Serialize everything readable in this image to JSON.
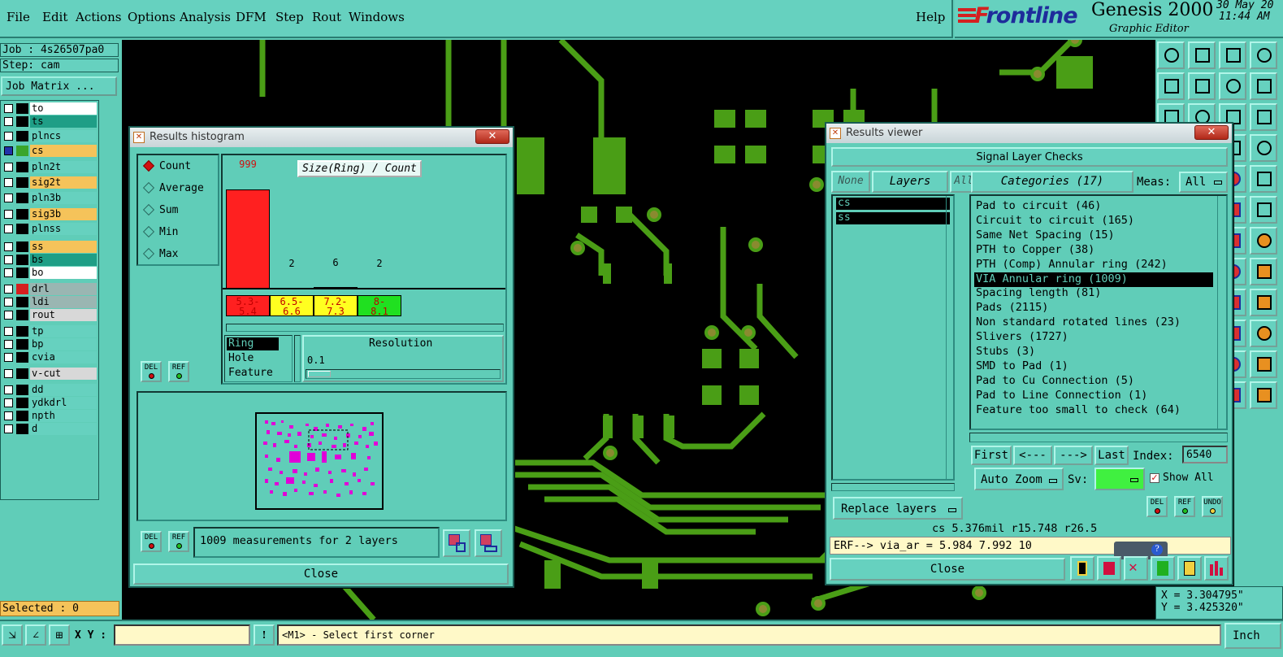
{
  "menubar": {
    "items": [
      "File",
      "Edit",
      "Actions",
      "Options",
      "Analysis",
      "DFM",
      "Step",
      "Rout",
      "Windows"
    ],
    "help": "Help"
  },
  "brand": {
    "logo_f": "F",
    "logo_rest": "rontline",
    "product": "Genesis 2000",
    "subtitle": "Graphic Editor",
    "date": "30 May 20",
    "time": "11:44 AM"
  },
  "left": {
    "job": "Job : 4s26507pa0",
    "step": "Step: cam",
    "job_matrix": "Job Matrix ...",
    "selected": "Selected : 0",
    "layers": [
      {
        "name": "to",
        "swatch": "#000000",
        "bg": "#ffffff",
        "check": "#ffffff"
      },
      {
        "name": "ts",
        "swatch": "#000000",
        "bg": "#1f9e86",
        "check": "#ffffff"
      },
      {
        "name": "plncs",
        "swatch": "#000000",
        "bg": "#66d1bf",
        "check": "#ffffff"
      },
      {
        "name": "cs",
        "swatch": "#3aa52a",
        "bg": "#f5c35a",
        "check": "#2233aa"
      },
      {
        "name": "pln2t",
        "swatch": "#000000",
        "bg": "#66d1bf",
        "check": "#ffffff"
      },
      {
        "name": "sig2t",
        "swatch": "#000000",
        "bg": "#f5c35a",
        "check": "#ffffff"
      },
      {
        "name": "pln3b",
        "swatch": "#000000",
        "bg": "#66d1bf",
        "check": "#ffffff"
      },
      {
        "name": "sig3b",
        "swatch": "#000000",
        "bg": "#f5c35a",
        "check": "#ffffff"
      },
      {
        "name": "plnss",
        "swatch": "#000000",
        "bg": "#66d1bf",
        "check": "#ffffff"
      },
      {
        "name": "ss",
        "swatch": "#000000",
        "bg": "#f5c35a",
        "check": "#ffffff"
      },
      {
        "name": "bs",
        "swatch": "#000000",
        "bg": "#1f9e86",
        "check": "#ffffff"
      },
      {
        "name": "bo",
        "swatch": "#000000",
        "bg": "#ffffff",
        "check": "#ffffff"
      },
      {
        "name": "drl",
        "swatch": "#d42020",
        "bg": "#9ab6b2",
        "check": "#ffffff"
      },
      {
        "name": "ldi",
        "swatch": "#000000",
        "bg": "#9ab6b2",
        "check": "#ffffff"
      },
      {
        "name": "rout",
        "swatch": "#000000",
        "bg": "#d8d8d8",
        "check": "#ffffff"
      },
      {
        "name": "tp",
        "swatch": "#000000",
        "bg": "#66d1bf",
        "check": "#ffffff"
      },
      {
        "name": "bp",
        "swatch": "#000000",
        "bg": "#66d1bf",
        "check": "#ffffff"
      },
      {
        "name": "cvia",
        "swatch": "#000000",
        "bg": "#66d1bf",
        "check": "#ffffff"
      },
      {
        "name": "v-cut",
        "swatch": "#000000",
        "bg": "#d8d8d8",
        "check": "#ffffff"
      },
      {
        "name": "dd",
        "swatch": "#000000",
        "bg": "#66d1bf",
        "check": "#ffffff"
      },
      {
        "name": "ydkdrl",
        "swatch": "#000000",
        "bg": "#66d1bf",
        "check": "#ffffff"
      },
      {
        "name": "npth",
        "swatch": "#000000",
        "bg": "#66d1bf",
        "check": "#ffffff"
      },
      {
        "name": "d",
        "swatch": "#000000",
        "bg": "#66d1bf",
        "check": "#ffffff"
      }
    ]
  },
  "histogram": {
    "title": "Results histogram",
    "modes": [
      "Count",
      "Average",
      "Sum",
      "Min",
      "Max"
    ],
    "selected_mode": "Count",
    "chart_title": "Size(Ring) / Count",
    "bars": [
      {
        "range": "5.3-\n5.4",
        "count": "999",
        "value": 999,
        "color": "#ff2020",
        "count_color": "#d01010"
      },
      {
        "range": "6.5-\n6.6",
        "count": "2",
        "value": 2,
        "color": "#ffff20",
        "count_color": "#000000"
      },
      {
        "range": "7.2-\n7.3",
        "count": "6",
        "value": 6,
        "color": "#ffff20",
        "count_color": "#000000"
      },
      {
        "range": "8-\n8.1",
        "count": "2",
        "value": 2,
        "color": "#20e020",
        "count_color": "#000000"
      }
    ],
    "measures": [
      "Ring",
      "Hole",
      "Feature"
    ],
    "selected_measure": "Ring",
    "resolution_label": "Resolution",
    "resolution_value": "0.1",
    "del": "DEL",
    "ref": "REF",
    "summary": "1009 measurements for 2 layers",
    "close": "Close"
  },
  "viewer": {
    "title": "Results viewer",
    "header": "Signal Layer Checks",
    "none": "None",
    "layers_btn": "Layers",
    "all": "All",
    "categories_btn": "Categories (17)",
    "meas_label": "Meas:",
    "meas_value": "All",
    "layer_items": [
      "cs",
      "ss"
    ],
    "categories": [
      "Pad to circuit (46)",
      "Circuit to circuit (165)",
      "Same Net Spacing (15)",
      "PTH to Copper (38)",
      "PTH (Comp) Annular ring (242)",
      "VIA Annular ring (1009)",
      "Spacing length (81)",
      "Pads (2115)",
      "Non standard rotated lines (23)",
      "Slivers (1727)",
      "Stubs (3)",
      "SMD to Pad (1)",
      "Pad to Cu Connection (5)",
      "Pad to Line Connection (1)",
      "Feature too small to check (64)"
    ],
    "selected_category": "VIA Annular ring (1009)",
    "first": "First",
    "prev": "<---",
    "next": "--->",
    "last": "Last",
    "index_label": "Index:",
    "index_value": "6540",
    "auto_zoom": "Auto Zoom",
    "sv_label": "Sv:",
    "show_all": "Show All",
    "replace_layers": "Replace layers",
    "del": "DEL",
    "ref": "REF",
    "undo": "UNDO",
    "info_line": "cs 5.376mil  r15.748  r26.5",
    "erf_line": "ERF--> via_ar = 5.984 7.992 10",
    "close": "Close"
  },
  "coords": {
    "x": "X = 3.304795\"",
    "y": "Y = 3.425320\""
  },
  "status": {
    "xy_label": "X Y :",
    "xy_value": "",
    "prompt": "<M1> - Select first corner",
    "units": "Inch",
    "alert": "!"
  }
}
